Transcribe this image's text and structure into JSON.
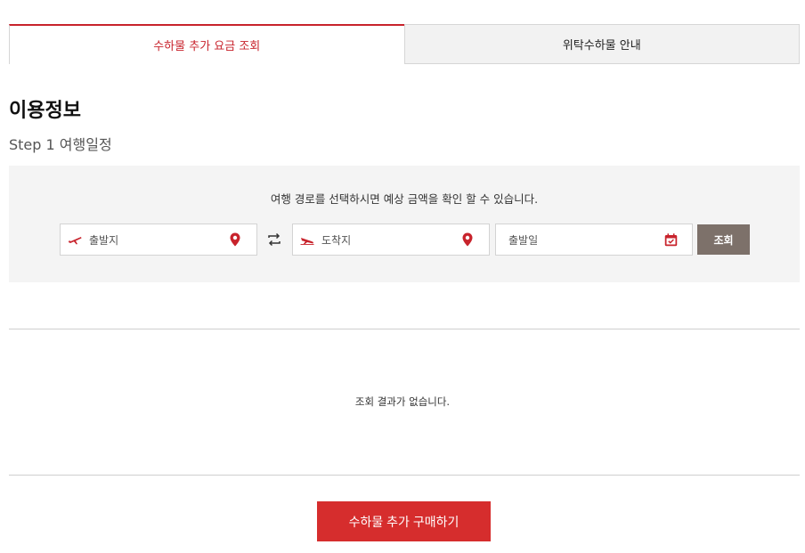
{
  "tabs": [
    {
      "label": "수하물 추가 요금 조회",
      "active": true
    },
    {
      "label": "위탁수하물 안내",
      "active": false
    }
  ],
  "section_title": "이용정보",
  "step_title": "Step 1 여행일정",
  "search": {
    "description": "여행 경로를 선택하시면 예상 금액을 확인 할 수 있습니다.",
    "departure_placeholder": "출발지",
    "arrival_placeholder": "도착지",
    "date_placeholder": "출발일",
    "search_label": "조회"
  },
  "results": {
    "empty_message": "조회 결과가 없습니다."
  },
  "purchase_label": "수하물 추가 구매하기",
  "colors": {
    "accent": "#c8232c",
    "search_button": "#7d716a",
    "purchase_button": "#d62d2d",
    "panel_bg": "#f4f4f4"
  },
  "icons": {
    "departure": "plane-takeoff-icon",
    "arrival": "plane-landing-icon",
    "location": "location-pin-icon",
    "swap": "swap-arrows-icon",
    "calendar": "calendar-check-icon"
  }
}
